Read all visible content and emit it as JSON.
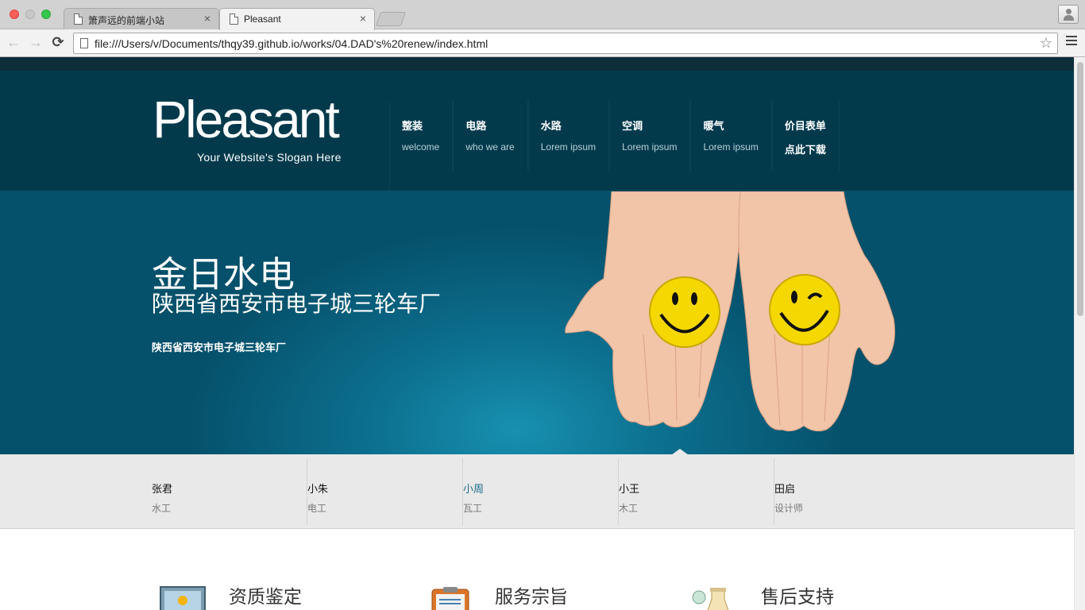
{
  "browser": {
    "tabs": [
      {
        "title": "箫声远的前端小站"
      },
      {
        "title": "Pleasant"
      }
    ],
    "tab_close": "×",
    "url": "file:///Users/v/Documents/thqy39.github.io/works/04.DAD's%20renew/index.html",
    "icons": {
      "back": "←",
      "forward": "→",
      "reload": "⟳",
      "bookmark": "☆"
    }
  },
  "site": {
    "logo": "Pleasant",
    "slogan": "Your Website's Slogan Here",
    "nav": [
      {
        "zh": "整装",
        "en": "welcome"
      },
      {
        "zh": "电路",
        "en": "who we are"
      },
      {
        "zh": "水路",
        "en": "Lorem ipsum"
      },
      {
        "zh": "空调",
        "en": "Lorem ipsum"
      },
      {
        "zh": "暖气",
        "en": "Lorem ipsum"
      },
      {
        "zh": "价目表单",
        "en": "点此下载"
      }
    ],
    "hero": {
      "title": "金日水电",
      "subtitle": "陕西省西安市电子城三轮车厂",
      "small": "陕西省西安市电子城三轮车厂"
    },
    "team": [
      {
        "name": "张君",
        "role": "水工"
      },
      {
        "name": "小朱",
        "role": "电工"
      },
      {
        "name": "小周",
        "role": "瓦工"
      },
      {
        "name": "小王",
        "role": "木工"
      },
      {
        "name": "田启",
        "role": "设计师"
      }
    ],
    "features": [
      {
        "title": "资质鉴定",
        "icon": "certificate-icon"
      },
      {
        "title": "服务宗旨",
        "icon": "clipboard-icon"
      },
      {
        "title": "售后支持",
        "icon": "flask-icon"
      }
    ],
    "colors": {
      "header_bg": "#023a4c",
      "hero_bg": "#0c6f8e",
      "accent": "#1b6f8b",
      "team_bg": "#e9e9e9"
    }
  }
}
